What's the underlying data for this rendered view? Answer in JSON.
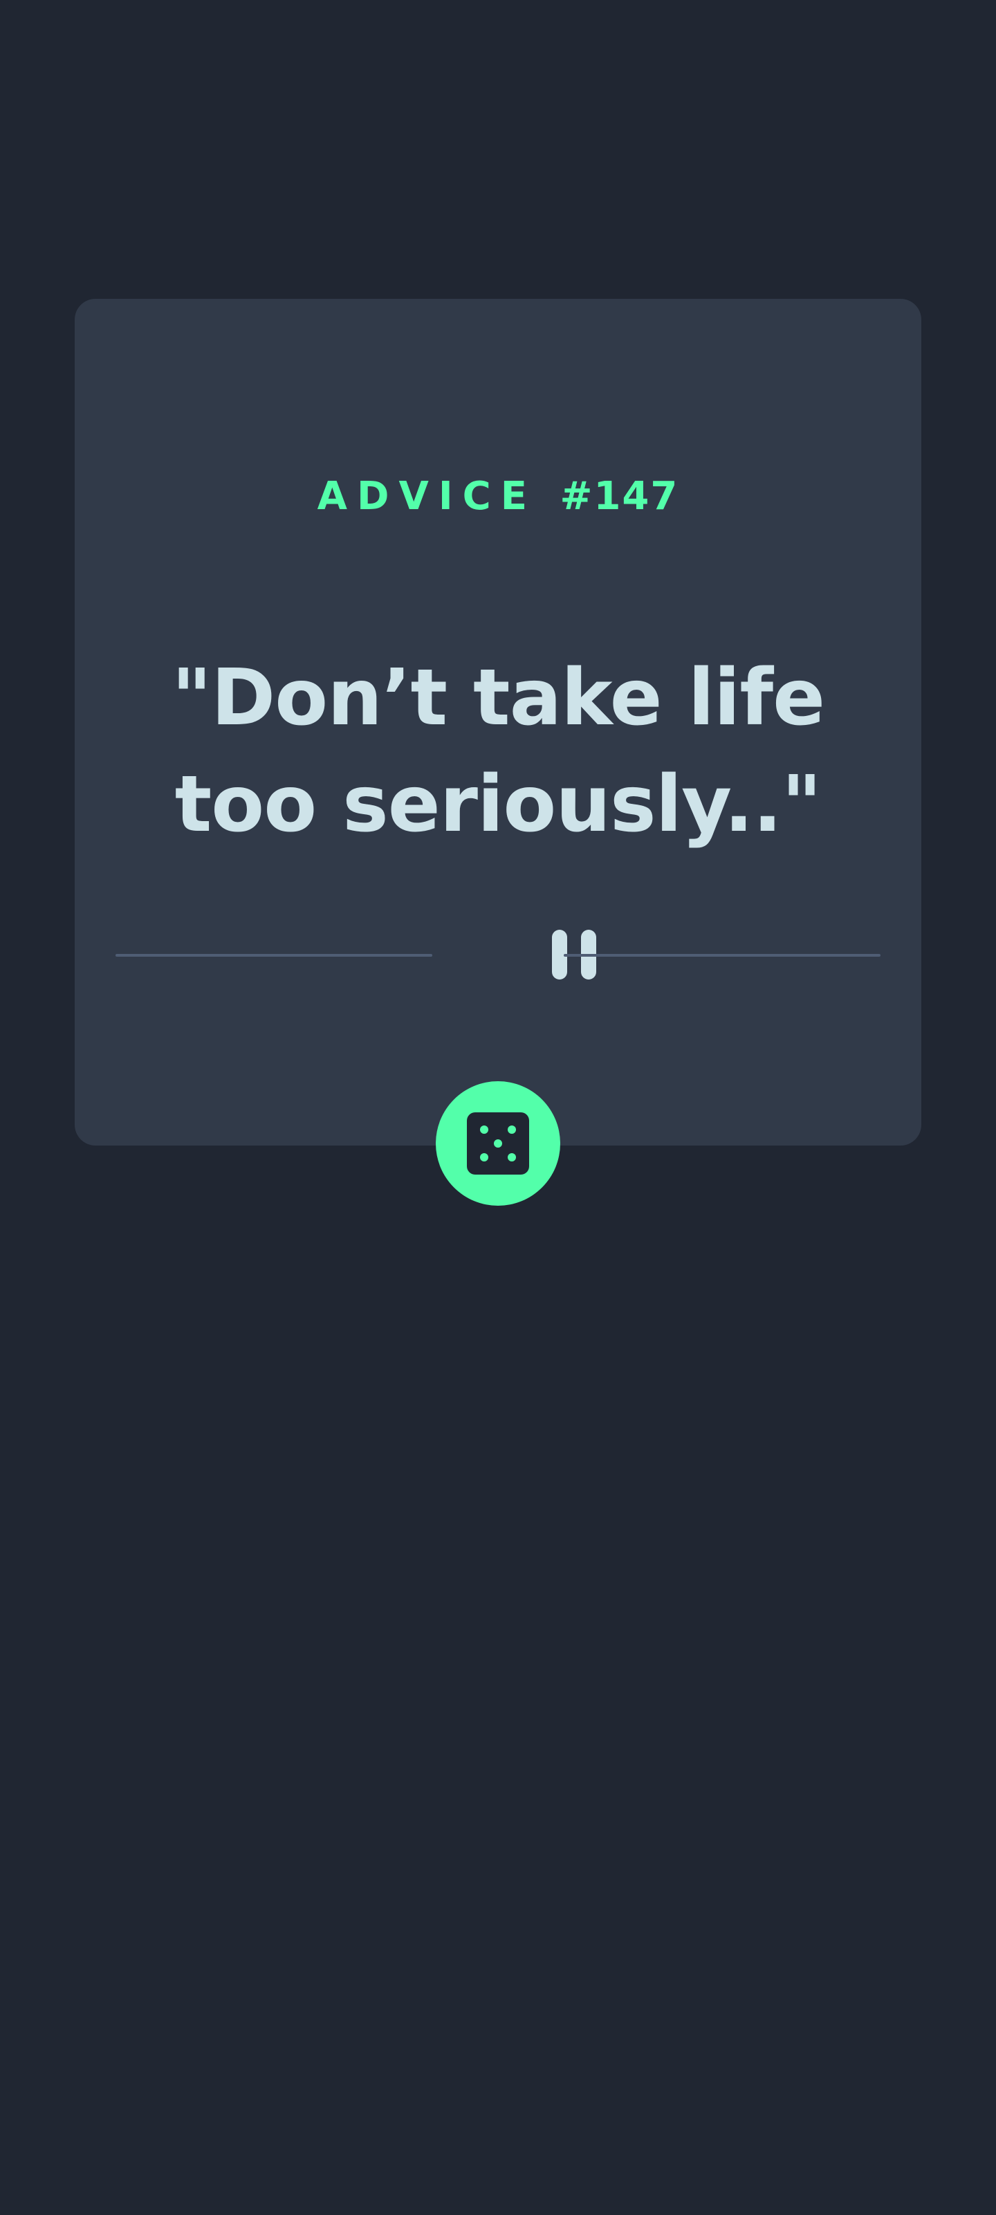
{
  "advice": {
    "label": "ADVICE",
    "number": "#147",
    "quote": "\"Don’t take life too seriously..\""
  },
  "colors": {
    "background": "#202632",
    "card": "#313a49",
    "accent": "#53ffaa",
    "text": "#cee3e9",
    "divider": "#4f5d74"
  },
  "icons": {
    "divider": "pause-icon",
    "button": "dice-icon"
  }
}
